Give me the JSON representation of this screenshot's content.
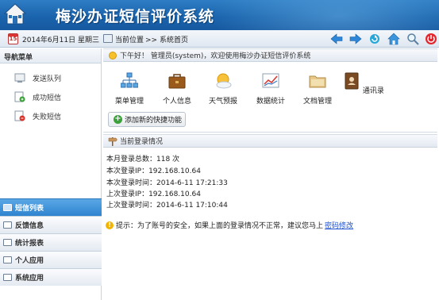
{
  "app": {
    "title": "梅沙办证短信评价系统"
  },
  "toolbar": {
    "date_icon_number": "15",
    "date": "2014年6月11日 星期三",
    "location_label": "当前位置",
    "breadcrumb": ">> 系统首页",
    "buttons": [
      "back-arrow-icon",
      "forward-arrow-icon",
      "refresh-icon",
      "home-icon",
      "search-icon",
      "power-icon"
    ]
  },
  "sidebar": {
    "title": "导航菜单",
    "items": [
      {
        "label": "发送队列",
        "icon": "send-queue-icon"
      },
      {
        "label": "成功短信",
        "icon": "success-message-icon"
      },
      {
        "label": "失败短信",
        "icon": "failed-message-icon"
      }
    ],
    "menus": [
      {
        "label": "短信列表",
        "active": true
      },
      {
        "label": "反馈信息",
        "active": false
      },
      {
        "label": "统计报表",
        "active": false
      },
      {
        "label": "个人应用",
        "active": false
      },
      {
        "label": "系统应用",
        "active": false
      }
    ]
  },
  "welcome": {
    "text": "下午好！ 管理员(system)，欢迎使用梅沙办证短信评价系统"
  },
  "quick": {
    "items": [
      {
        "label": "菜单管理",
        "icon": "org-chart-icon"
      },
      {
        "label": "个人信息",
        "icon": "briefcase-icon"
      },
      {
        "label": "天气预报",
        "icon": "weather-icon"
      },
      {
        "label": "数据统计",
        "icon": "chart-icon"
      },
      {
        "label": "文档管理",
        "icon": "folder-icon"
      },
      {
        "label": "通讯录",
        "icon": "address-book-icon"
      }
    ],
    "add_button": "添加新的快捷功能"
  },
  "login": {
    "title": "当前登录情况",
    "lines": [
      "本月登录总数：118 次",
      "本次登录IP：192.168.10.64",
      "本次登录时间：2014-6-11 17:21:33",
      "上次登录IP：192.168.10.64",
      "上次登录时间：2014-6-11 17:10:44"
    ]
  },
  "tip": {
    "text": "提示：为了账号的安全，如果上面的登录情况不正常，建议您马上",
    "link": "密码修改"
  },
  "colors": {
    "header": "#1a64ad",
    "active_menu": "#2f84cf",
    "link": "#1a4fd0"
  }
}
